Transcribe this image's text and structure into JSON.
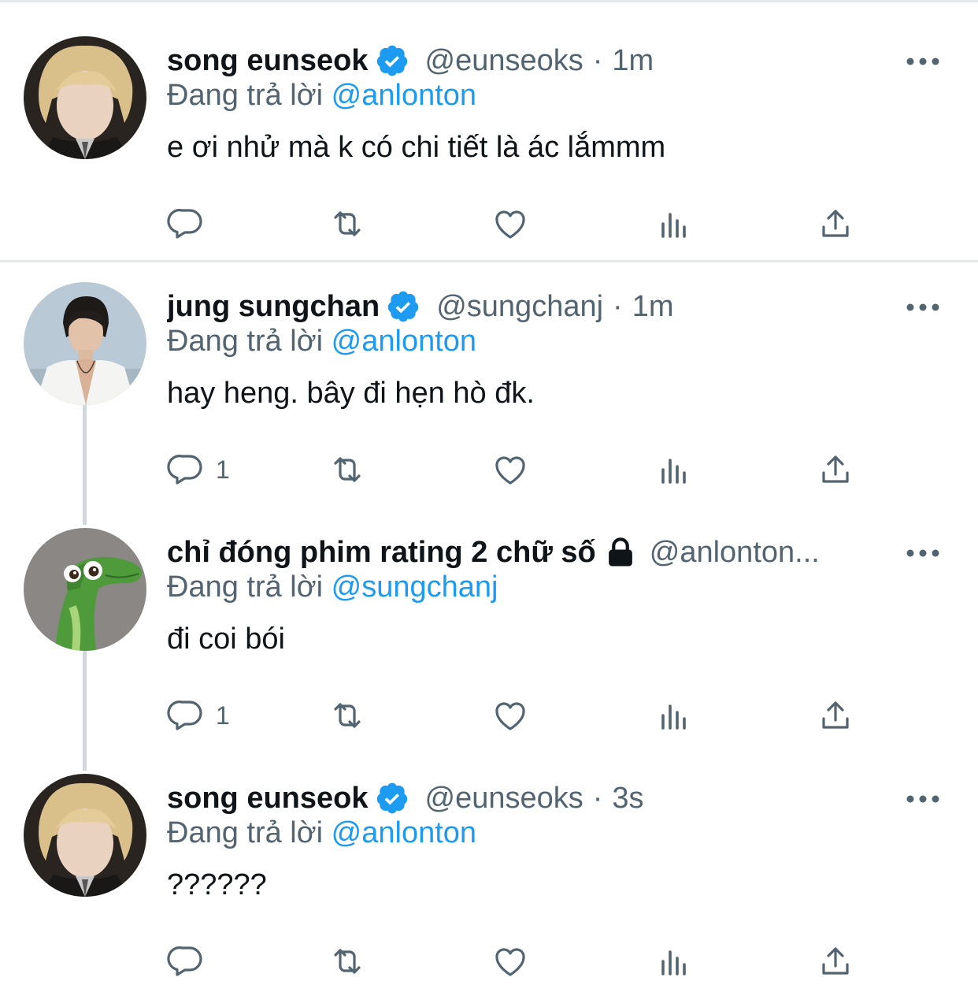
{
  "tweets": [
    {
      "display_name": "song eunseok",
      "handle": "@eunseoks",
      "time": "1m",
      "reply_prefix": "Đang trả lời",
      "reply_to": "@anlonton",
      "text": "e ơi nhử mà k có chi tiết là ác lắmmm",
      "verified": true,
      "reply_count": ""
    },
    {
      "display_name": "jung sungchan",
      "handle": "@sungchanj",
      "time": "1m",
      "reply_prefix": "Đang trả lời",
      "reply_to": "@anlonton",
      "text": "hay heng. bây đi hẹn hò đk.",
      "verified": true,
      "reply_count": "1"
    },
    {
      "display_name": "chỉ đóng phim rating 2 chữ số",
      "handle": "@anlonton...",
      "time": "",
      "reply_prefix": "Đang trả lời",
      "reply_to": "@sungchanj",
      "text": "đi coi bói",
      "protected": true,
      "reply_count": "1"
    },
    {
      "display_name": "song eunseok",
      "handle": "@eunseoks",
      "time": "3s",
      "reply_prefix": "Đang trả lời",
      "reply_to": "@anlonton",
      "text": "??????",
      "verified": true,
      "reply_count": ""
    }
  ],
  "icons": {
    "verified": "verified-badge-icon",
    "lock": "lock-icon",
    "more": "more-icon",
    "reply": "reply-icon",
    "retweet": "retweet-icon",
    "like": "like-icon",
    "analytics": "analytics-icon",
    "share": "share-icon"
  },
  "colors": {
    "accent": "#1d9bf0",
    "secondary_text": "#536471",
    "icon": "#536471",
    "thread_line": "#cfd9de",
    "divider": "#e6e9ec"
  }
}
